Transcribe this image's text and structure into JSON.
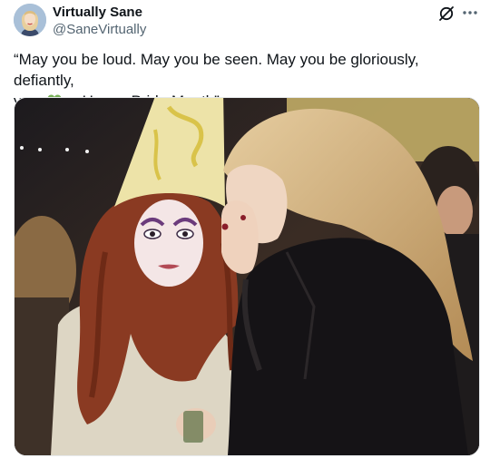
{
  "author": {
    "display_name": "Virtually Sane",
    "handle": "@SaneVirtually"
  },
  "tweet": {
    "text_line1": "“May you be loud. May you be seen. May you be gloriously, defiantly,",
    "text_line2_start": "you.",
    "text_line2_end": "Happy Pride Month”",
    "emojis": [
      "green-heart",
      "rainbow"
    ]
  },
  "icons": {
    "grok": "grok-icon",
    "more": "more-icon"
  },
  "colors": {
    "text": "#0f1419",
    "secondary": "#536471"
  }
}
